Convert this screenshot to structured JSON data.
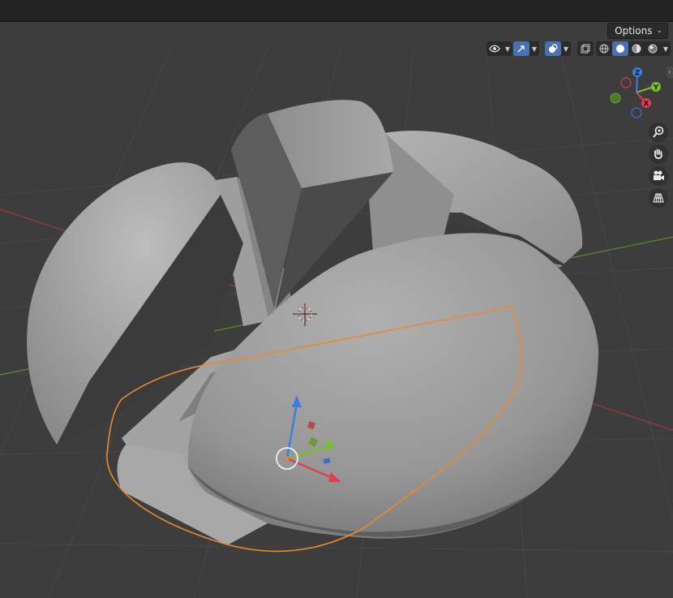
{
  "header": {
    "options_label": "Options"
  },
  "gizmo": {
    "z_label": "Z",
    "y_label": "Y",
    "x_label": "X"
  },
  "colors": {
    "background": "#3d3d3d",
    "grid": "#474747",
    "x_axis": "#9a3a40",
    "y_axis": "#5e8a2a",
    "selection_outline": "#e88a2e",
    "accent_blue": "#4772b3"
  },
  "icons": {
    "visibility": "eye-icon",
    "gizmo_toggle": "gizmo-arrow-icon",
    "overlay_toggle": "overlay-icon",
    "xray": "xray-icon",
    "shading_modes": [
      "wireframe-shading-icon",
      "solid-shading-icon",
      "material-shading-icon",
      "rendered-shading-icon"
    ],
    "navigation": [
      "zoom-icon",
      "pan-hand-icon",
      "camera-icon",
      "perspective-grid-icon"
    ]
  },
  "shading": {
    "selected_mode": "solid"
  }
}
